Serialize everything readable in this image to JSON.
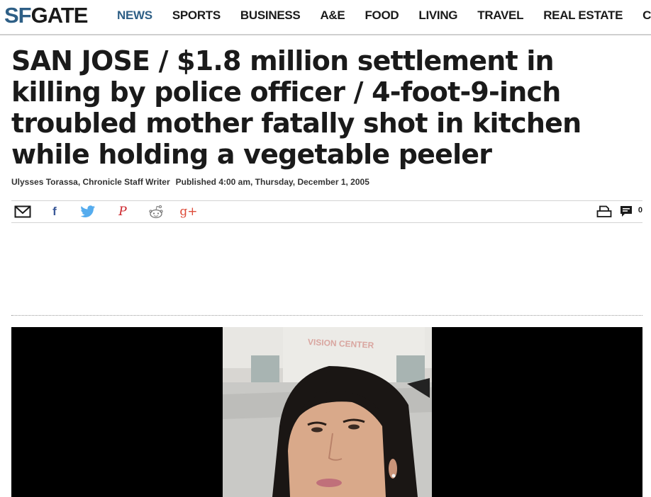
{
  "brand": {
    "logo_sf": "SF",
    "logo_gate": "GATE"
  },
  "nav": {
    "items": [
      {
        "label": "NEWS",
        "active": true
      },
      {
        "label": "SPORTS"
      },
      {
        "label": "BUSINESS"
      },
      {
        "label": "A&E"
      },
      {
        "label": "FOOD"
      },
      {
        "label": "LIVING"
      },
      {
        "label": "TRAVEL"
      },
      {
        "label": "REAL ESTATE"
      },
      {
        "label": "CA"
      }
    ]
  },
  "article": {
    "headline": "SAN JOSE / $1.8 million settlement in killing by police officer / 4-foot-9-inch troubled mother fatally shot in kitchen while holding a vegetable peeler",
    "author": "Ulysses Torassa, Chronicle Staff Writer",
    "published": "Published 4:00 am, Thursday, December 1, 2005",
    "photo_sign_text": "VISION CENTER"
  },
  "share": {
    "icons": [
      "email-icon",
      "facebook-icon",
      "twitter-icon",
      "pinterest-icon",
      "reddit-icon",
      "google-plus-icon",
      "print-icon",
      "comment-icon"
    ],
    "facebook_glyph": "f",
    "pinterest_glyph": "P",
    "google_plus_glyph": "g+",
    "comment_count": "0"
  },
  "colors": {
    "brand_blue": "#2e5f86",
    "facebook": "#3b5998",
    "twitter": "#55acee",
    "pinterest": "#cb2027",
    "google_plus": "#dd4b39",
    "text": "#1a1a1a"
  }
}
